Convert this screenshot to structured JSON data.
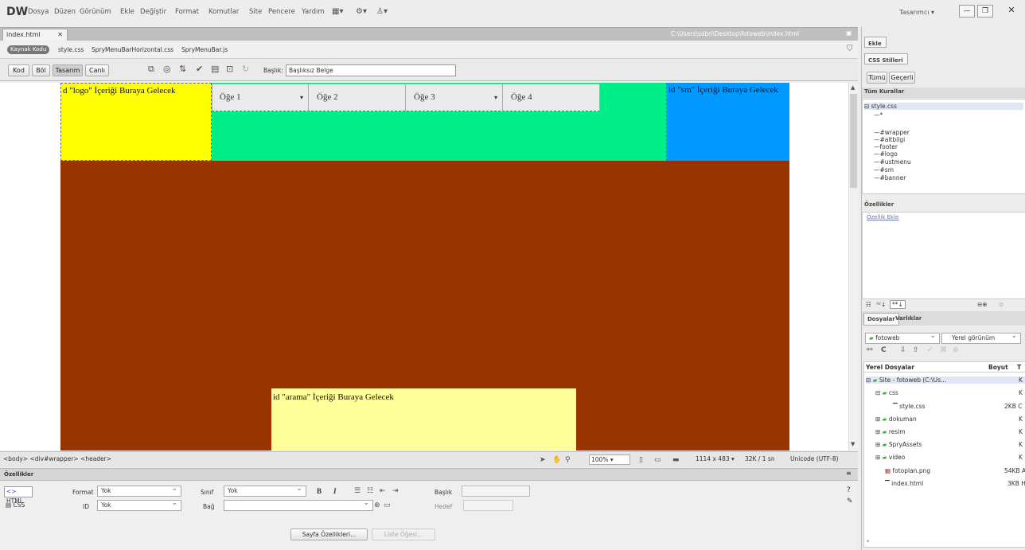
{
  "app": {
    "logo": "DW",
    "menu": [
      "Dosya",
      "Düzen",
      "Görünüm",
      "Ekle",
      "Değiştir",
      "Format",
      "Komutlar",
      "Site",
      "Pencere",
      "Yardım"
    ],
    "workspace": "Tasarımcı"
  },
  "doc": {
    "tab": "index.html",
    "path": "C:\\Users\\sabri\\Desktop\\fotoweb\\index.html",
    "related": [
      "Kaynak Kodu",
      "style.css",
      "SpryMenuBarHorizontal.css",
      "SpryMenuBar.js"
    ]
  },
  "toolbar": {
    "kod": "Kod",
    "bol": "Böl",
    "tasarim": "Tasarım",
    "canli": "Canlı",
    "title_label": "Başlık:",
    "title_value": "Başlıksız Belge"
  },
  "design": {
    "logo": "d \"logo\" İçeriği Buraya Gelecek",
    "menu": [
      "Öğe 1",
      "Öğe 2",
      "Öğe 3",
      "Öğe 4"
    ],
    "sm": "id \"sm\" İçeriği Buraya Gelecek",
    "arama": "id \"arama\" İçeriği Buraya Gelecek",
    "colors": {
      "logo": "#ffff00",
      "menuband": "#00ee88",
      "sm": "#0099ff",
      "body": "#993300",
      "arama": "#ffff99"
    }
  },
  "status": {
    "tags": "<body> <div#wrapper> <header>",
    "zoom": "100%",
    "size": "1114 x 483",
    "weight": "32K / 1 sn",
    "encoding": "Unicode (UTF-8)"
  },
  "props": {
    "title": "Özellikler",
    "html": "HTML",
    "css": "CSS",
    "format_label": "Format",
    "format_val": "Yok",
    "id_label": "ID",
    "id_val": "Yok",
    "class_label": "Sınıf",
    "class_val": "Yok",
    "link_label": "Bağ",
    "heading_label": "Başlık",
    "target_label": "Hedef",
    "page_props": "Sayfa Özellikleri...",
    "list_item": "Liste Öğesi..."
  },
  "right": {
    "ekle": "Ekle",
    "css_panel": "CSS Stilleri",
    "tumu": "Tümü",
    "gecerli": "Geçerli",
    "all_rules": "Tüm Kurallar",
    "stylesheet": "style.css",
    "rules": [
      "*",
      "#wrapper",
      "#altbilgi",
      "footer",
      "#logo",
      "#ustmenu",
      "#sm",
      "#banner"
    ],
    "ozellikler": "Özellikler",
    "add_prop": "Özellik Ekle",
    "dosyalar": "Dosyalar",
    "varliklar": "Varlıklar",
    "site": "fotoweb",
    "view": "Yerel görünüm",
    "local_files": "Yerel Dosyalar",
    "boyut": "Boyut",
    "tur": "T",
    "files": [
      {
        "name": "Site - fotoweb (C:\\Us...",
        "size": "K"
      },
      {
        "name": "css",
        "size": "K"
      },
      {
        "name": "style.css",
        "size": "2KB C"
      },
      {
        "name": "dokuman",
        "size": "K"
      },
      {
        "name": "resim",
        "size": "K"
      },
      {
        "name": "SpryAssets",
        "size": "K"
      },
      {
        "name": "video",
        "size": "K"
      },
      {
        "name": "fotoplan.png",
        "size": "54KB A"
      },
      {
        "name": "index.html",
        "size": "3KB H"
      }
    ]
  }
}
